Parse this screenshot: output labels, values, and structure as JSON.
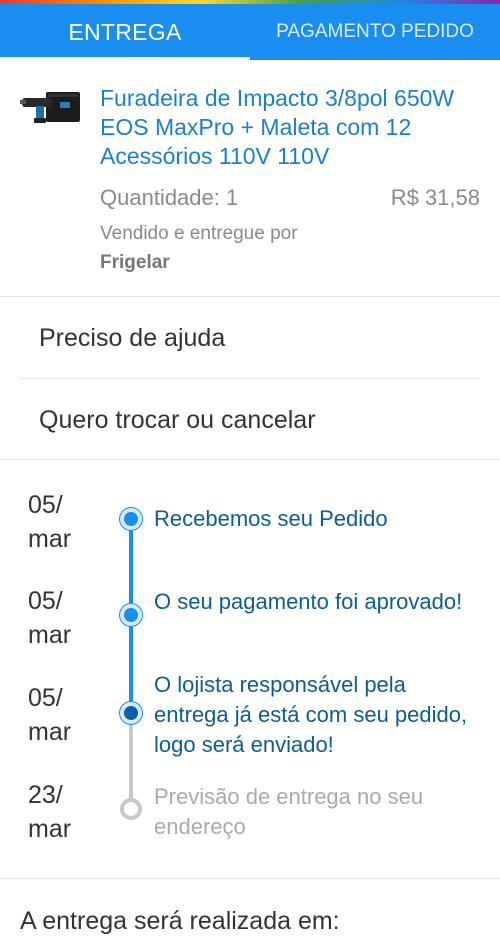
{
  "tabs": [
    {
      "label": "ENTREGA",
      "active": true
    },
    {
      "label": "PAGAMENTO PEDIDO",
      "active": false
    }
  ],
  "colors": {
    "accent": "#1a8df0",
    "link": "#1a7fd1",
    "timeline_text": "#0e5c95",
    "muted": "#8a8a8a"
  },
  "product": {
    "image_icon": "power-drill-with-case",
    "title": "Furadeira de Impacto 3/8pol 650W EOS MaxPro + Maleta com 12 Acessórios 110V 110V",
    "quantity": "Quantidade: 1",
    "price": "R$ 31,58",
    "sold_by_label": "Vendido e entregue por",
    "seller": "Frigelar"
  },
  "help": {
    "need_help": "Preciso de ajuda",
    "exchange_cancel": "Quero trocar ou cancelar"
  },
  "timeline": [
    {
      "date_day": "05/",
      "date_month": "mar",
      "text": "Recebemos seu Pedido",
      "status": "done"
    },
    {
      "date_day": "05/",
      "date_month": "mar",
      "text": "O seu pagamento foi aprovado!",
      "status": "done"
    },
    {
      "date_day": "05/",
      "date_month": "mar",
      "text": "O lojista responsável pela entrega já está com seu pedido, logo será enviado!",
      "status": "current"
    },
    {
      "date_day": "23/",
      "date_month": "mar",
      "text": "Previsão de entrega no seu endereço",
      "status": "future"
    }
  ],
  "delivery": {
    "label": "A entrega será realizada em:"
  }
}
